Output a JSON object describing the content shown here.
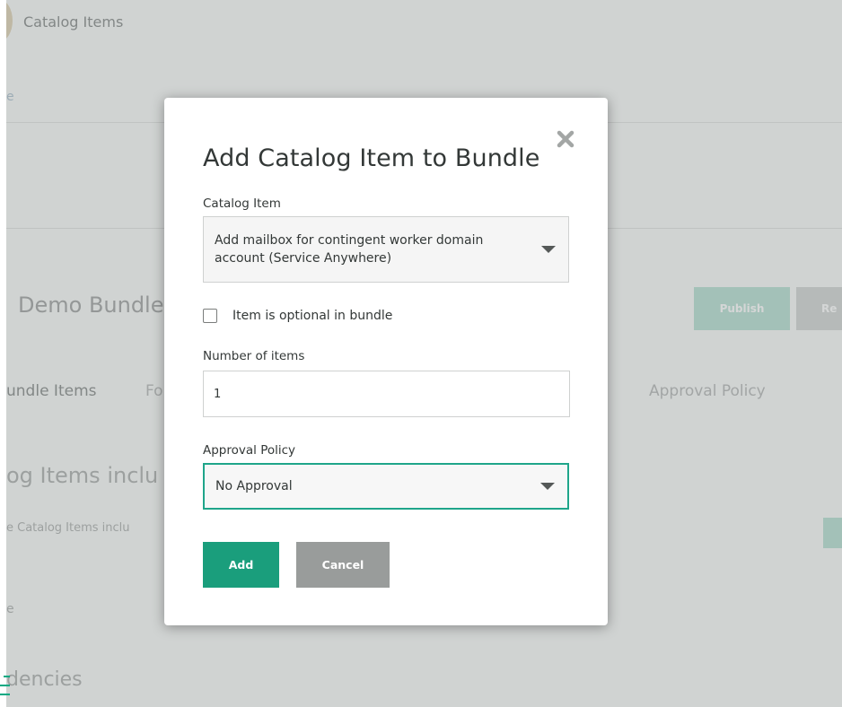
{
  "background": {
    "header_title": "Catalog Items",
    "link_fragment_top": "e",
    "page_title": "Demo Bundle",
    "publish_label": "Publish",
    "second_button_label": "Re",
    "tabs": {
      "bundle_items": "undle Items",
      "second_tab_fragment": "Fo",
      "approval_policy": "Approval Policy"
    },
    "section_heading": "og Items inclu",
    "section_subtext": "e Catalog Items inclu",
    "link_fragment_bottom": "e",
    "dependencies_heading": "dencies"
  },
  "dialog": {
    "title": "Add Catalog Item to Bundle",
    "close_symbol": "✖",
    "catalog_item": {
      "label": "Catalog Item",
      "selected_value": "Add mailbox for contingent worker domain account (Service Anywhere)"
    },
    "optional_checkbox": {
      "label": "Item is optional in bundle",
      "checked": false
    },
    "number_of_items": {
      "label": "Number of items",
      "value": "1"
    },
    "approval_policy": {
      "label": "Approval Policy",
      "selected_value": "No Approval"
    },
    "add_button_label": "Add",
    "cancel_button_label": "Cancel"
  },
  "colors": {
    "primary_green": "#1a9e7c",
    "focus_border": "#1fa58a",
    "cancel_gray": "#999c9b",
    "overlay": "rgba(160,165,163,0.45)"
  },
  "icons": {
    "close": "close-icon",
    "dropdown": "chevron-down-icon"
  }
}
